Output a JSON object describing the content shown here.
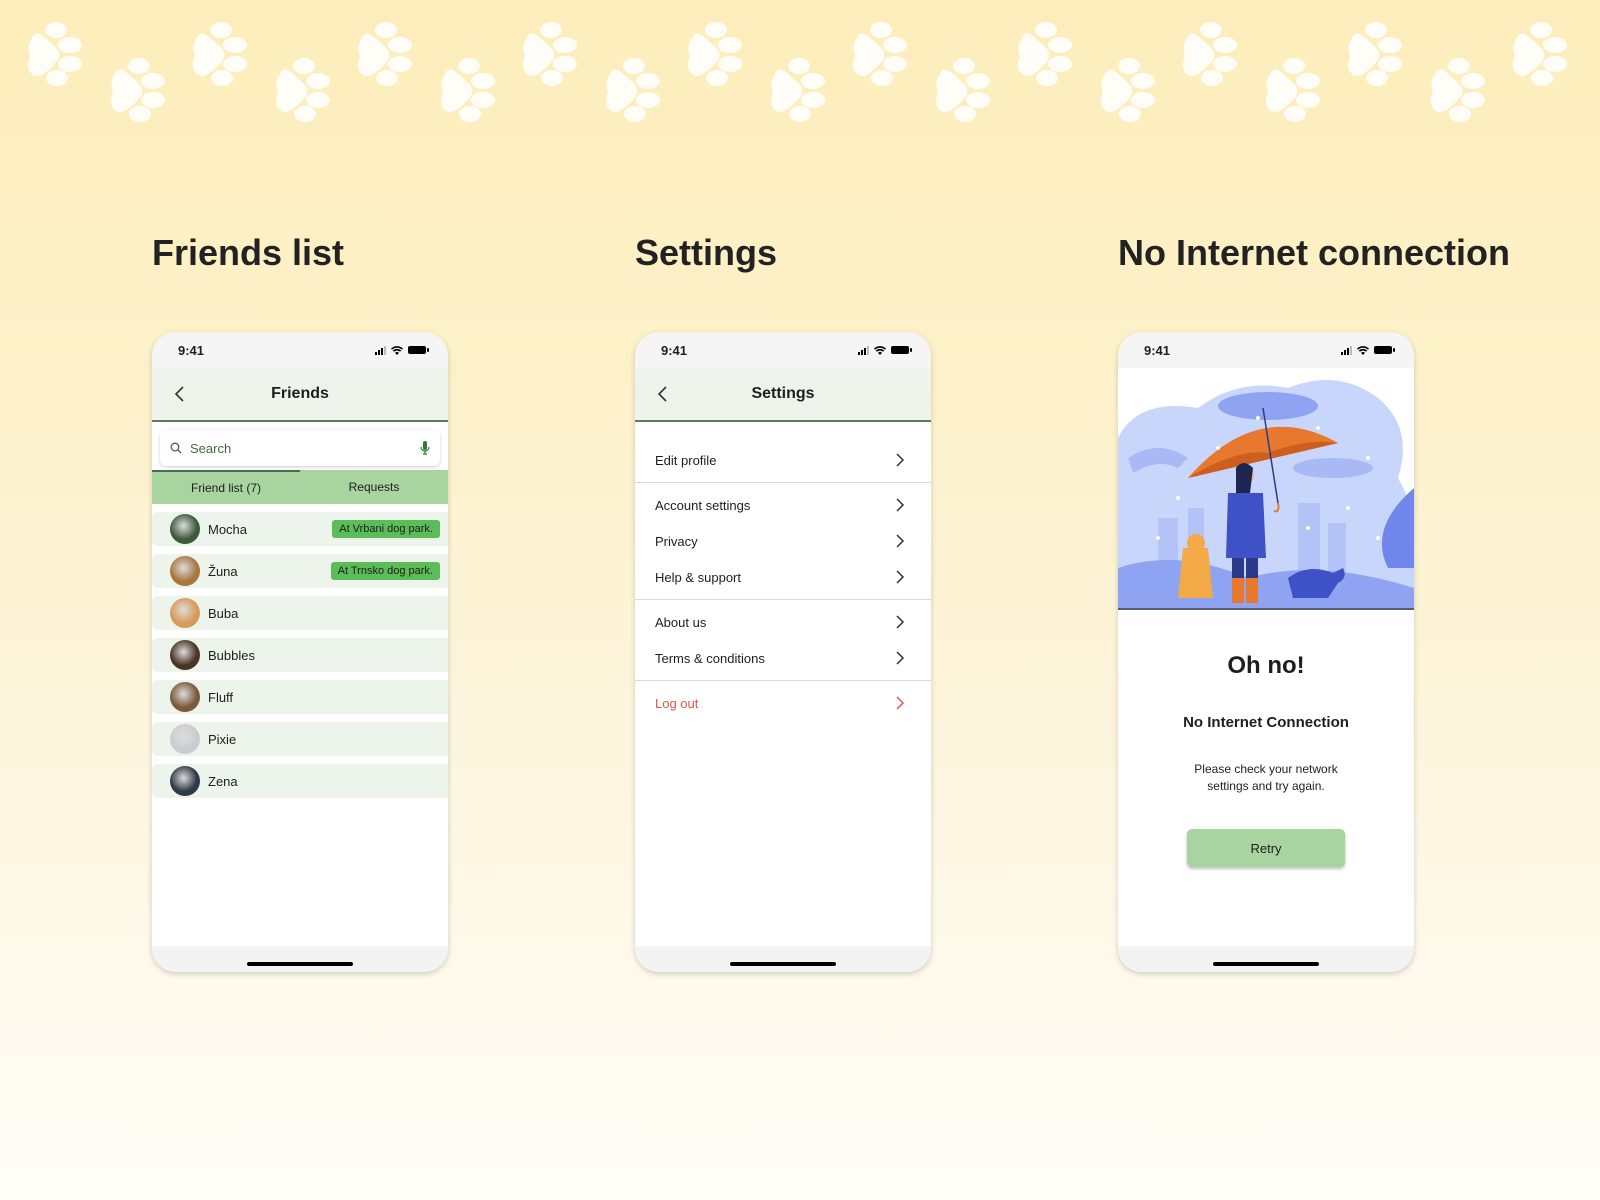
{
  "sections": {
    "friends_title": "Friends list",
    "settings_title": "Settings",
    "no_internet_title": "No Internet connection"
  },
  "status_bar": {
    "time": "9:41"
  },
  "friends_screen": {
    "nav_title": "Friends",
    "search_placeholder": "Search",
    "tabs": [
      {
        "label": "Friend list (7)",
        "active": true
      },
      {
        "label": "Requests",
        "active": false
      }
    ],
    "friends": [
      {
        "name": "Mocha",
        "location": "At Vrbani dog park.",
        "avatar_color": "#3d5a3a"
      },
      {
        "name": "Žuna",
        "location": "At Trnsko dog park.",
        "avatar_color": "#a8763e"
      },
      {
        "name": "Buba",
        "location": "",
        "avatar_color": "#d69a5a"
      },
      {
        "name": "Bubbles",
        "location": "",
        "avatar_color": "#4a3426"
      },
      {
        "name": "Fluff",
        "location": "",
        "avatar_color": "#7a5a3a"
      },
      {
        "name": "Pixie",
        "location": "",
        "avatar_color": "#c9cdd0"
      },
      {
        "name": "Zena",
        "location": "",
        "avatar_color": "#2f3a48"
      }
    ],
    "badge_color": "#5cbc58"
  },
  "settings_screen": {
    "nav_title": "Settings",
    "groups": [
      [
        {
          "label": "Edit profile"
        }
      ],
      [
        {
          "label": "Account settings"
        },
        {
          "label": "Privacy"
        },
        {
          "label": "Help & support"
        }
      ],
      [
        {
          "label": "About us"
        },
        {
          "label": "Terms & conditions"
        }
      ],
      [
        {
          "label": "Log out",
          "danger": true
        }
      ]
    ],
    "danger_color": "#e5534b"
  },
  "no_internet_screen": {
    "title": "Oh no!",
    "subtitle": "No Internet Connection",
    "body": "Please check your network settings and try again.",
    "retry_label": "Retry",
    "button_color": "#a8d4a0"
  }
}
